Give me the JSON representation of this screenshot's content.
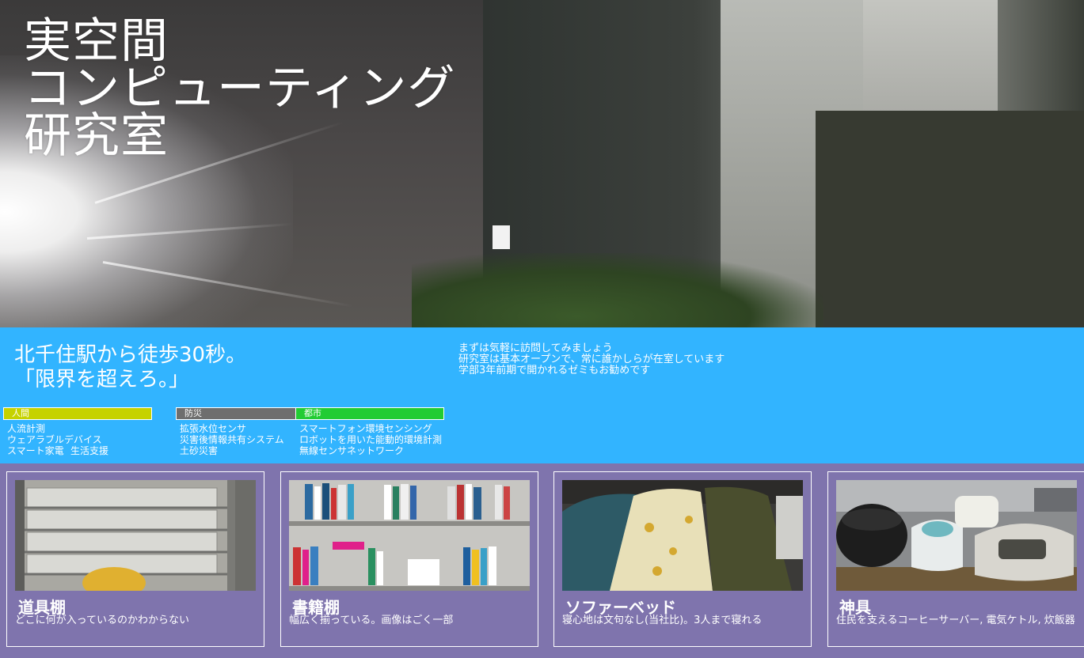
{
  "hero": {
    "title_lines": [
      "実空間",
      "コンピューティング",
      "研究室"
    ]
  },
  "intro": {
    "tagline_lines": [
      "北千住駅から徒歩30秒。",
      "「限界を超えろ。」"
    ],
    "notes": [
      "まずは気軽に訪問してみましょう",
      "研究室は基本オープンで、常に誰かしらが在室しています",
      "学部3年前期で開かれるゼミもお勧めです"
    ]
  },
  "categories": [
    {
      "label": "人間",
      "color": "#c6d200",
      "items": [
        "人流計測",
        "ウェアラブルデバイス",
        "スマート家電",
        "生活支援"
      ]
    },
    {
      "label": "防災",
      "color": "#6e6e6e",
      "items": [
        "拡張水位センサ",
        "災害後情報共有システム",
        "土砂災害"
      ]
    },
    {
      "label": "都市",
      "color": "#22cc33",
      "items": [
        "スマートフォン環境センシング",
        "ロボットを用いた能動的環境計測",
        "無線センサネットワーク"
      ]
    }
  ],
  "cards": [
    {
      "title": "道具棚",
      "desc": "どこに何が入っているのかわからない",
      "photo_icon": "shelf-photo"
    },
    {
      "title": "書籍棚",
      "desc": "幅広く揃っている。画像はごく一部",
      "photo_icon": "bookshelf-photo"
    },
    {
      "title": "ソファーベッド",
      "desc": "寝心地は文句なし(当社比)。3人まで寝れる",
      "photo_icon": "sleeping-bag-photo"
    },
    {
      "title": "神具",
      "desc": "住民を支えるコーヒーサーバー, 電気ケトル, 炊飯器",
      "photo_icon": "appliances-photo"
    }
  ],
  "colors": {
    "info_bg": "#32b4ff",
    "cards_bg": "#7f74ad"
  }
}
